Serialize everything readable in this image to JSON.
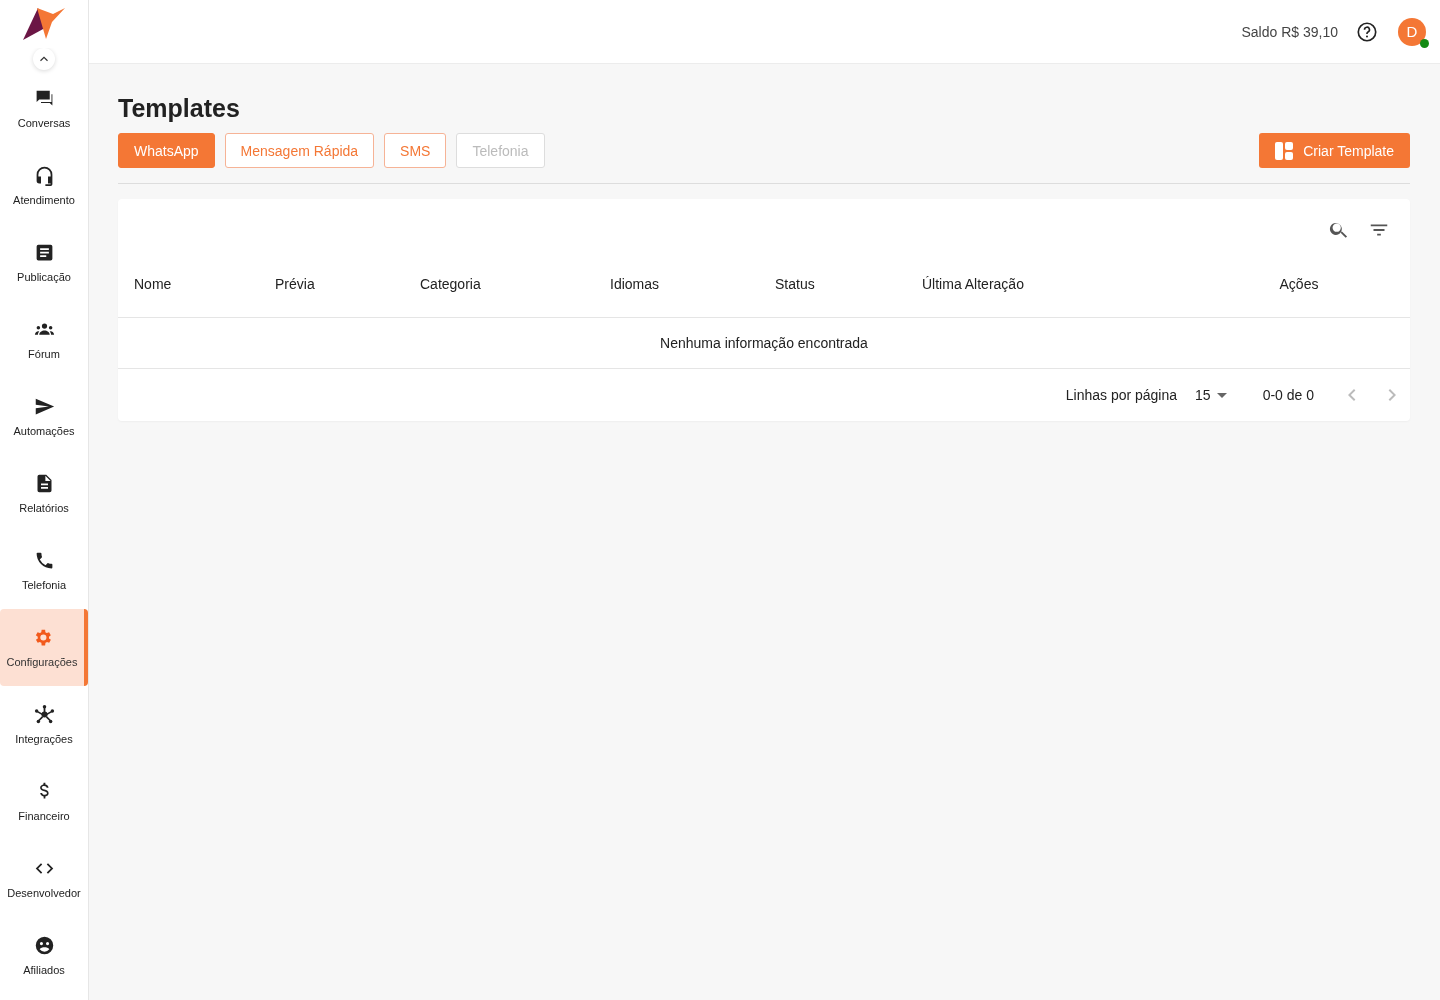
{
  "sidebar": {
    "items": [
      {
        "label": "Conversas",
        "selected": false
      },
      {
        "label": "Atendimento",
        "selected": false
      },
      {
        "label": "Publicação",
        "selected": false
      },
      {
        "label": "Fórum",
        "selected": false
      },
      {
        "label": "Automações",
        "selected": false
      },
      {
        "label": "Relatórios",
        "selected": false
      },
      {
        "label": "Telefonia",
        "selected": false
      },
      {
        "label": "Configurações",
        "selected": true
      },
      {
        "label": "Integrações",
        "selected": false
      },
      {
        "label": "Financeiro",
        "selected": false
      },
      {
        "label": "Desenvolvedor",
        "selected": false
      },
      {
        "label": "Afiliados",
        "selected": false
      }
    ]
  },
  "header": {
    "balance": "Saldo R$ 39,10",
    "avatar": "D",
    "online": true
  },
  "page": {
    "title": "Templates",
    "tabs": [
      {
        "label": "WhatsApp",
        "selected": true,
        "disabled": false
      },
      {
        "label": "Mensagem Rápida",
        "selected": false,
        "disabled": false
      },
      {
        "label": "SMS",
        "selected": false,
        "disabled": false
      },
      {
        "label": "Telefonia",
        "selected": false,
        "disabled": true
      }
    ],
    "create_button": "Criar Template"
  },
  "table": {
    "columns": [
      "Nome",
      "Prévia",
      "Categoria",
      "Idiomas",
      "Status",
      "Última Alteração",
      "Ações"
    ],
    "empty_message": "Nenhuma informação encontrada",
    "pagination": {
      "rows_label": "Linhas por página",
      "rows_per_page": "15",
      "range": "0-0 de 0"
    }
  }
}
